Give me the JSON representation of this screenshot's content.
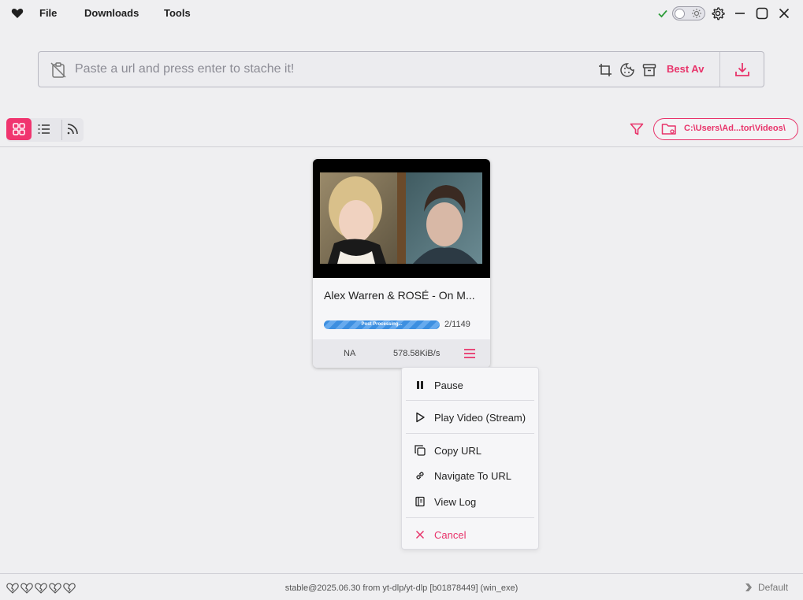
{
  "titlebar": {
    "menu": [
      "File",
      "Downloads",
      "Tools"
    ]
  },
  "urlbar": {
    "placeholder": "Paste a url and press enter to stache it!",
    "quality": "Best Av"
  },
  "toolbar": {
    "download_path": "C:\\Users\\Ad...tor\\Videos\\"
  },
  "card": {
    "title": "Alex Warren & ROSÉ - On M...",
    "progress_label": "Post Processing...",
    "progress_count": "2/1149",
    "size": "NA",
    "speed": "578.58KiB/s"
  },
  "context_menu": {
    "items": [
      {
        "label": "Pause",
        "icon": "pause-icon"
      },
      {
        "label": "Play Video (Stream)",
        "icon": "play-icon"
      },
      {
        "label": "Copy URL",
        "icon": "copy-icon"
      },
      {
        "label": "Navigate To URL",
        "icon": "link-icon"
      },
      {
        "label": "View Log",
        "icon": "log-icon"
      },
      {
        "label": "Cancel",
        "icon": "close-icon"
      }
    ]
  },
  "statusbar": {
    "version": "stable@2025.06.30 from yt-dlp/yt-dlp [b01878449] (win_exe)",
    "profile": "Default"
  },
  "colors": {
    "accent": "#e8336a",
    "progress": "#3d8fe0",
    "success": "#2e9d3b"
  }
}
